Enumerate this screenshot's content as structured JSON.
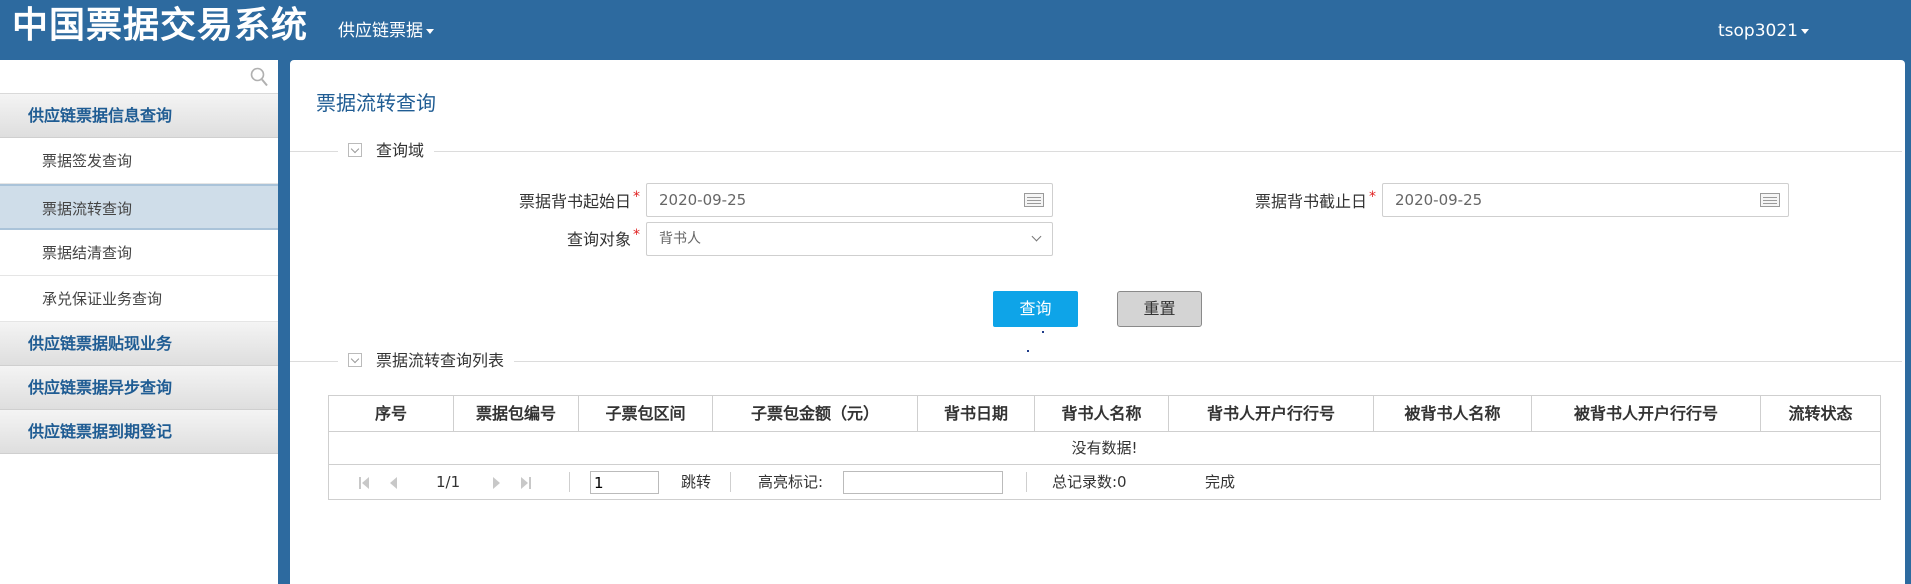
{
  "header": {
    "app_title": "中国票据交易系统",
    "menu_label": "供应链票据",
    "user_label": "tsop3021"
  },
  "sidebar": {
    "search_placeholder": "",
    "groups": [
      {
        "label": "供应链票据信息查询",
        "items": [
          {
            "label": "票据签发查询"
          },
          {
            "label": "票据流转查询",
            "active": true
          },
          {
            "label": "票据结清查询"
          },
          {
            "label": "承兑保证业务查询"
          }
        ]
      },
      {
        "label": "供应链票据贴现业务"
      },
      {
        "label": "供应链票据异步查询"
      },
      {
        "label": "供应链票据到期登记"
      }
    ]
  },
  "main": {
    "page_title": "票据流转查询",
    "query_section_title": "查询域",
    "form": {
      "start_date_label": "票据背书起始日",
      "start_date_value": "2020-09-25",
      "end_date_label": "票据背书截止日",
      "end_date_value": "2020-09-25",
      "target_label": "查询对象",
      "target_value": "背书人",
      "required_mark": "*"
    },
    "buttons": {
      "query": "查询",
      "reset": "重置"
    },
    "list_section_title": "票据流转查询列表",
    "table": {
      "columns": [
        "序号",
        "票据包编号",
        "子票包区间",
        "子票包金额（元）",
        "背书日期",
        "背书人名称",
        "背书人开户行行号",
        "被背书人名称",
        "被背书人开户行行号",
        "流转状态"
      ],
      "empty_text": "没有数据!"
    },
    "pager": {
      "page_info": "1/1",
      "page_input": "1",
      "jump_label": "跳转",
      "highlight_label": "高亮标记:",
      "highlight_value": "",
      "total_label": "总记录数:0",
      "status": "完成"
    }
  },
  "colors": {
    "header_bg": "#2d6a9f",
    "primary_button": "#0ea4e8",
    "nav_text": "#1f5c93",
    "active_nav_bg": "#cfdde9"
  }
}
